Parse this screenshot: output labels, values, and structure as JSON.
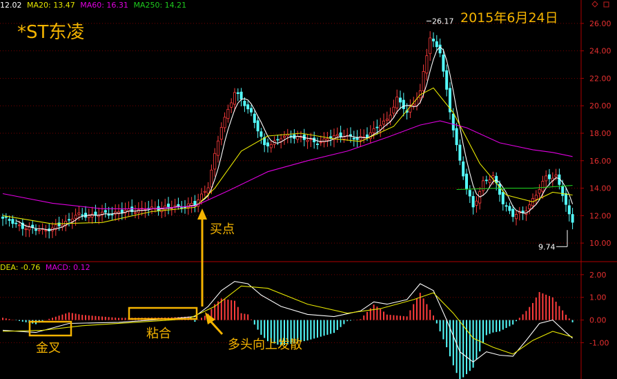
{
  "stock_title": "*ST东凌",
  "date_label": "2015年6月24日",
  "legend_top": {
    "ma5": "12.02",
    "ma20": "MA20: 13.47",
    "ma60": "MA60: 16.31",
    "ma250": "MA250: 14.21"
  },
  "legend_bottom": {
    "dea": "DEA: -0.76",
    "macd": "MACD: 0.12"
  },
  "annotations": {
    "buy_point": "买点",
    "golden_cross": "金叉",
    "converge": "粘合",
    "bull_diverge": "多头向上发散",
    "high_label": "26.17",
    "low_label": "9.74"
  },
  "colors": {
    "up": "#ff3c3c",
    "down": "#54ffff",
    "ma5": "#ffffff",
    "ma20": "#e6e600",
    "ma60": "#e000e0",
    "ma250": "#1ecc1e",
    "frame": "#b00000",
    "axis_text": "#e83030",
    "note": "#f5b400"
  },
  "chart_data": [
    {
      "type": "candlestick",
      "title": "",
      "ylim": [
        9.0,
        27.0
      ],
      "yticks": [
        10,
        12,
        14,
        16,
        18,
        20,
        22,
        24,
        26
      ],
      "ytick_labels": [
        "10.00",
        "12.00",
        "14.00",
        "16.00",
        "18.00",
        "20.00",
        "22.00",
        "24.00",
        "26.00"
      ],
      "n_bars": 84,
      "annotated_high": 26.17,
      "annotated_low": 9.74,
      "close_control_points": [
        [
          0,
          11.8
        ],
        [
          8,
          11.0
        ],
        [
          15,
          11.0
        ],
        [
          22,
          12.0
        ],
        [
          30,
          12.1
        ],
        [
          40,
          12.4
        ],
        [
          50,
          12.6
        ],
        [
          58,
          12.8
        ],
        [
          62,
          14.2
        ],
        [
          66,
          18.5
        ],
        [
          70,
          21.0
        ],
        [
          75,
          19.5
        ],
        [
          79,
          17.0
        ],
        [
          84,
          17.7
        ],
        [
          89,
          17.8
        ],
        [
          94,
          17.3
        ],
        [
          98,
          17.6
        ],
        [
          103,
          17.9
        ],
        [
          107,
          17.5
        ],
        [
          112,
          18.2
        ],
        [
          116,
          19.0
        ],
        [
          119,
          20.5
        ],
        [
          122,
          19.5
        ],
        [
          126,
          21.0
        ],
        [
          129,
          25.0
        ],
        [
          132,
          24.0
        ],
        [
          135,
          19.5
        ],
        [
          138,
          16.0
        ],
        [
          140,
          14.0
        ],
        [
          142,
          12.5
        ],
        [
          145,
          14.5
        ],
        [
          148,
          14.8
        ],
        [
          151,
          13.0
        ],
        [
          154,
          12.0
        ],
        [
          157,
          12.2
        ],
        [
          161,
          13.5
        ],
        [
          164,
          14.8
        ],
        [
          167,
          14.9
        ],
        [
          169,
          13.5
        ],
        [
          171,
          12.0
        ],
        [
          172,
          11.6
        ]
      ],
      "series": [
        {
          "name": "MA20",
          "points": [
            [
              0,
              12.0
            ],
            [
              15,
              11.4
            ],
            [
              30,
              11.5
            ],
            [
              45,
              12.3
            ],
            [
              58,
              12.6
            ],
            [
              64,
              14.0
            ],
            [
              72,
              16.7
            ],
            [
              80,
              17.8
            ],
            [
              90,
              18.0
            ],
            [
              100,
              17.6
            ],
            [
              108,
              17.4
            ],
            [
              118,
              18.5
            ],
            [
              126,
              20.8
            ],
            [
              130,
              21.3
            ],
            [
              136,
              19.5
            ],
            [
              144,
              15.8
            ],
            [
              152,
              13.5
            ],
            [
              160,
              13.0
            ],
            [
              166,
              13.7
            ],
            [
              172,
              13.5
            ]
          ]
        },
        {
          "name": "MA60",
          "points": [
            [
              0,
              13.6
            ],
            [
              15,
              12.9
            ],
            [
              30,
              12.5
            ],
            [
              45,
              12.5
            ],
            [
              58,
              12.7
            ],
            [
              68,
              13.8
            ],
            [
              80,
              15.2
            ],
            [
              92,
              16.0
            ],
            [
              104,
              16.7
            ],
            [
              116,
              17.7
            ],
            [
              126,
              18.6
            ],
            [
              132,
              18.9
            ],
            [
              140,
              18.4
            ],
            [
              150,
              17.3
            ],
            [
              160,
              16.8
            ],
            [
              166,
              16.6
            ],
            [
              172,
              16.3
            ]
          ]
        },
        {
          "name": "MA250",
          "points": [
            [
              137,
              13.9
            ],
            [
              150,
              14.0
            ],
            [
              160,
              14.0
            ],
            [
              172,
              14.2
            ]
          ]
        }
      ]
    },
    {
      "type": "macd",
      "title": "",
      "ylim": [
        -2.6,
        2.3
      ],
      "yticks": [
        2,
        1,
        0,
        -1
      ],
      "ytick_labels": [
        "2.00",
        "1.00",
        "0.00",
        "-1.00"
      ],
      "dif_points": [
        [
          0,
          -0.45
        ],
        [
          10,
          -0.55
        ],
        [
          20,
          -0.15
        ],
        [
          35,
          -0.1
        ],
        [
          50,
          0.05
        ],
        [
          58,
          0.15
        ],
        [
          62,
          0.6
        ],
        [
          66,
          1.3
        ],
        [
          70,
          1.7
        ],
        [
          74,
          1.6
        ],
        [
          78,
          1.1
        ],
        [
          84,
          0.6
        ],
        [
          92,
          0.25
        ],
        [
          100,
          0.15
        ],
        [
          108,
          0.4
        ],
        [
          112,
          0.8
        ],
        [
          116,
          0.7
        ],
        [
          122,
          0.9
        ],
        [
          126,
          1.6
        ],
        [
          130,
          1.3
        ],
        [
          134,
          0.0
        ],
        [
          138,
          -1.4
        ],
        [
          142,
          -1.85
        ],
        [
          146,
          -1.4
        ],
        [
          150,
          -1.55
        ],
        [
          154,
          -1.6
        ],
        [
          158,
          -0.9
        ],
        [
          162,
          -0.15
        ],
        [
          166,
          0.0
        ],
        [
          170,
          -0.55
        ],
        [
          172,
          -0.8
        ]
      ],
      "dea_points": [
        [
          0,
          -0.5
        ],
        [
          12,
          -0.45
        ],
        [
          24,
          -0.25
        ],
        [
          40,
          -0.1
        ],
        [
          56,
          0.05
        ],
        [
          64,
          0.6
        ],
        [
          72,
          1.5
        ],
        [
          80,
          1.4
        ],
        [
          92,
          0.7
        ],
        [
          104,
          0.3
        ],
        [
          114,
          0.5
        ],
        [
          124,
          0.9
        ],
        [
          130,
          1.2
        ],
        [
          136,
          0.3
        ],
        [
          142,
          -0.8
        ],
        [
          148,
          -1.2
        ],
        [
          154,
          -1.5
        ],
        [
          160,
          -0.9
        ],
        [
          166,
          -0.5
        ],
        [
          172,
          -0.75
        ]
      ],
      "histogram": "2 × (DIF − DEA)"
    }
  ]
}
